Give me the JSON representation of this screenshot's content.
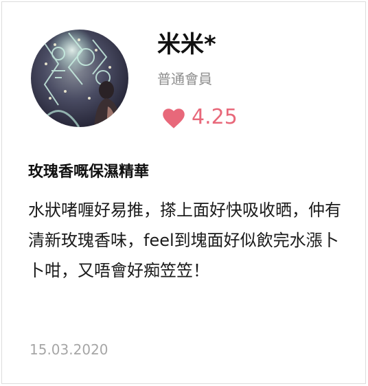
{
  "review": {
    "user": {
      "name": "米米*",
      "level": "普通會員"
    },
    "rating": {
      "value": "4.25",
      "icon": "heart-icon",
      "color": "#e8687a"
    },
    "title": "玫瑰香嘅保濕精華",
    "body": "水狀啫喱好易推，搽上面好快吸收晒，仲有清新玫瑰香味，feel到塊面好似飲完水漲卜卜咁，又唔會好痴笠笠！",
    "date": "15.03.2020"
  }
}
